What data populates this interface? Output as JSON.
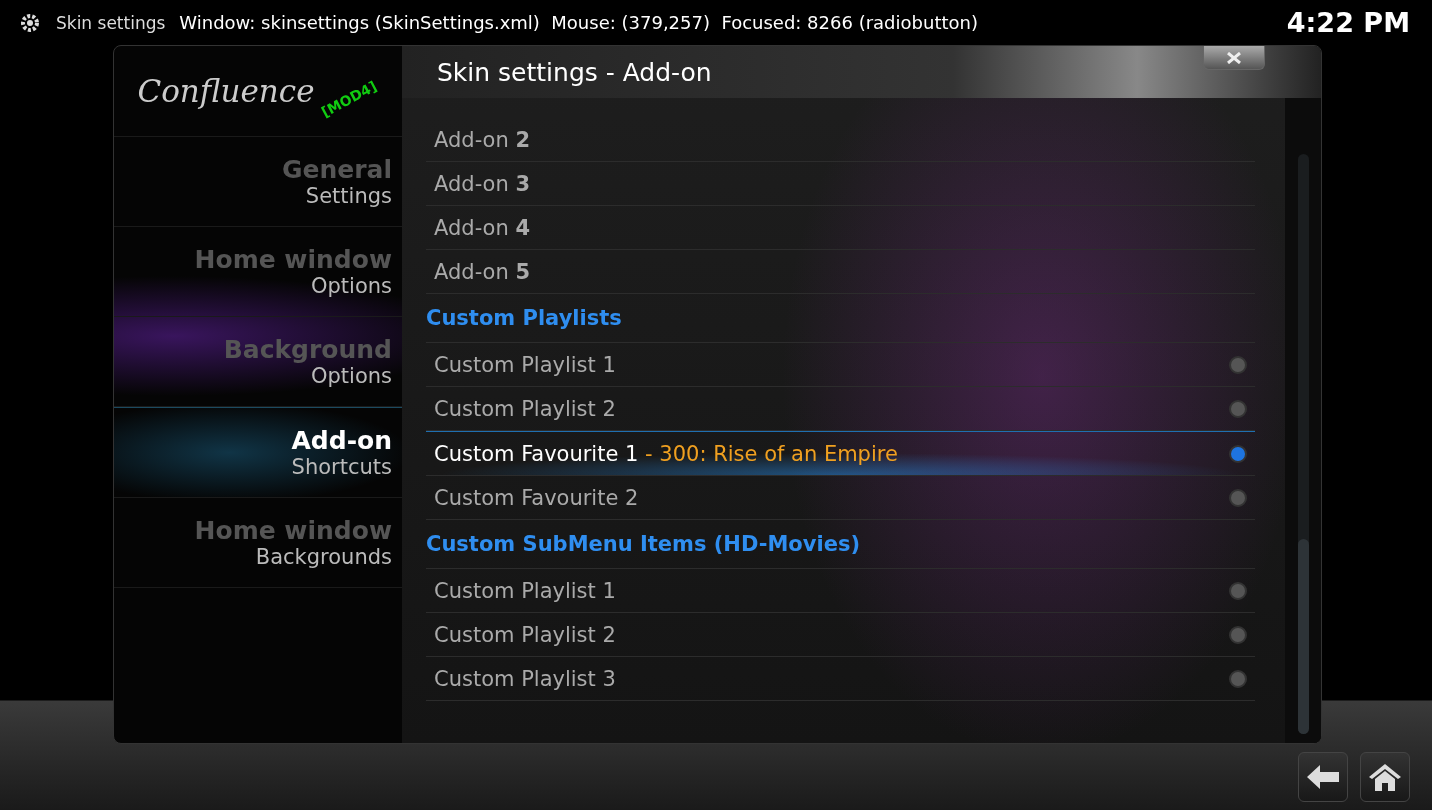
{
  "header": {
    "title": "Skin settings",
    "debug": "Window: skinsettings (SkinSettings.xml)  Mouse: (379,257)  Focused: 8266 (radiobutton)",
    "clock": "4:22 PM"
  },
  "logo": {
    "name": "Confluence",
    "badge": "[MOD4]"
  },
  "dialog": {
    "title": "Skin settings - Add-on"
  },
  "sidebar": [
    {
      "title": "General",
      "subtitle": "Settings",
      "selected": false
    },
    {
      "title": "Home window",
      "subtitle": "Options",
      "selected": false
    },
    {
      "title": "Background",
      "subtitle": "Options",
      "selected": false
    },
    {
      "title": "Add-on",
      "subtitle": "Shortcuts",
      "selected": true
    },
    {
      "title": "Home window",
      "subtitle": "Backgrounds",
      "selected": false
    }
  ],
  "rows": [
    {
      "kind": "item",
      "label": "Add-on **2**",
      "focused": false
    },
    {
      "kind": "item",
      "label": "Add-on **3**",
      "focused": false
    },
    {
      "kind": "item",
      "label": "Add-on **4**",
      "focused": false
    },
    {
      "kind": "item",
      "label": "Add-on **5**",
      "focused": false
    },
    {
      "kind": "header",
      "label": "Custom Playlists"
    },
    {
      "kind": "radio",
      "label": "Custom Playlist 1",
      "selected": false,
      "focused": false
    },
    {
      "kind": "radio",
      "label": "Custom Playlist 2",
      "selected": false,
      "focused": false
    },
    {
      "kind": "radio",
      "label": "Custom Favourite 1",
      "value": "- 300: Rise of an Empire",
      "selected": true,
      "focused": true
    },
    {
      "kind": "radio",
      "label": "Custom Favourite 2",
      "selected": false,
      "focused": false
    },
    {
      "kind": "header",
      "label": "Custom SubMenu Items (HD-Movies)"
    },
    {
      "kind": "radio",
      "label": "Custom Playlist 1",
      "selected": false,
      "focused": false
    },
    {
      "kind": "radio",
      "label": "Custom Playlist 2",
      "selected": false,
      "focused": false
    },
    {
      "kind": "radio",
      "label": "Custom Playlist 3",
      "selected": false,
      "focused": false
    }
  ]
}
